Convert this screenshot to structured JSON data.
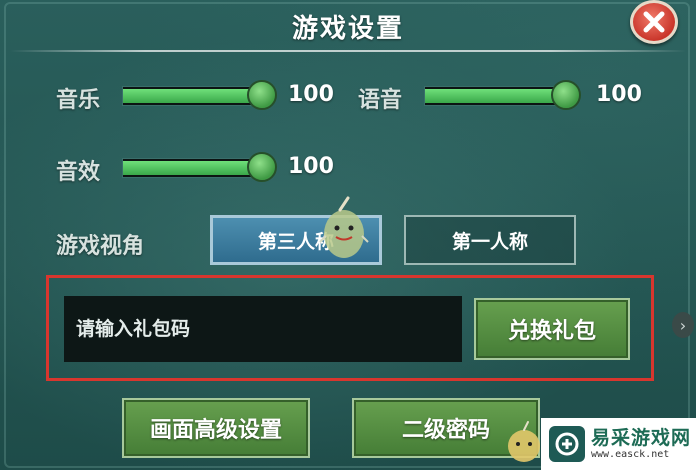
{
  "dialog": {
    "title": "游戏设置"
  },
  "settings": {
    "music": {
      "label": "音乐",
      "value": "100",
      "level": 1.0
    },
    "voice": {
      "label": "语音",
      "value": "100",
      "level": 1.0
    },
    "sfx": {
      "label": "音效",
      "value": "100",
      "level": 1.0
    }
  },
  "view": {
    "label": "游戏视角",
    "options": [
      "第三人称",
      "第一人称"
    ],
    "selected": "第三人称"
  },
  "redeem": {
    "placeholder": "请输入礼包码",
    "button_label": "兑换礼包"
  },
  "footer": {
    "graphics_button": "画面高级设置",
    "password_button": "二级密码"
  },
  "watermark": {
    "brand": "易采游戏网",
    "url": "www.easck.net"
  },
  "icons": {
    "close": "close-icon",
    "side_arrow": "chevron-right-icon",
    "mascot": "mascot-icon"
  },
  "colors": {
    "accent_green": "#3aa84a",
    "highlight_red": "#d8362e",
    "active_tab_blue": "#2f6c8e"
  }
}
